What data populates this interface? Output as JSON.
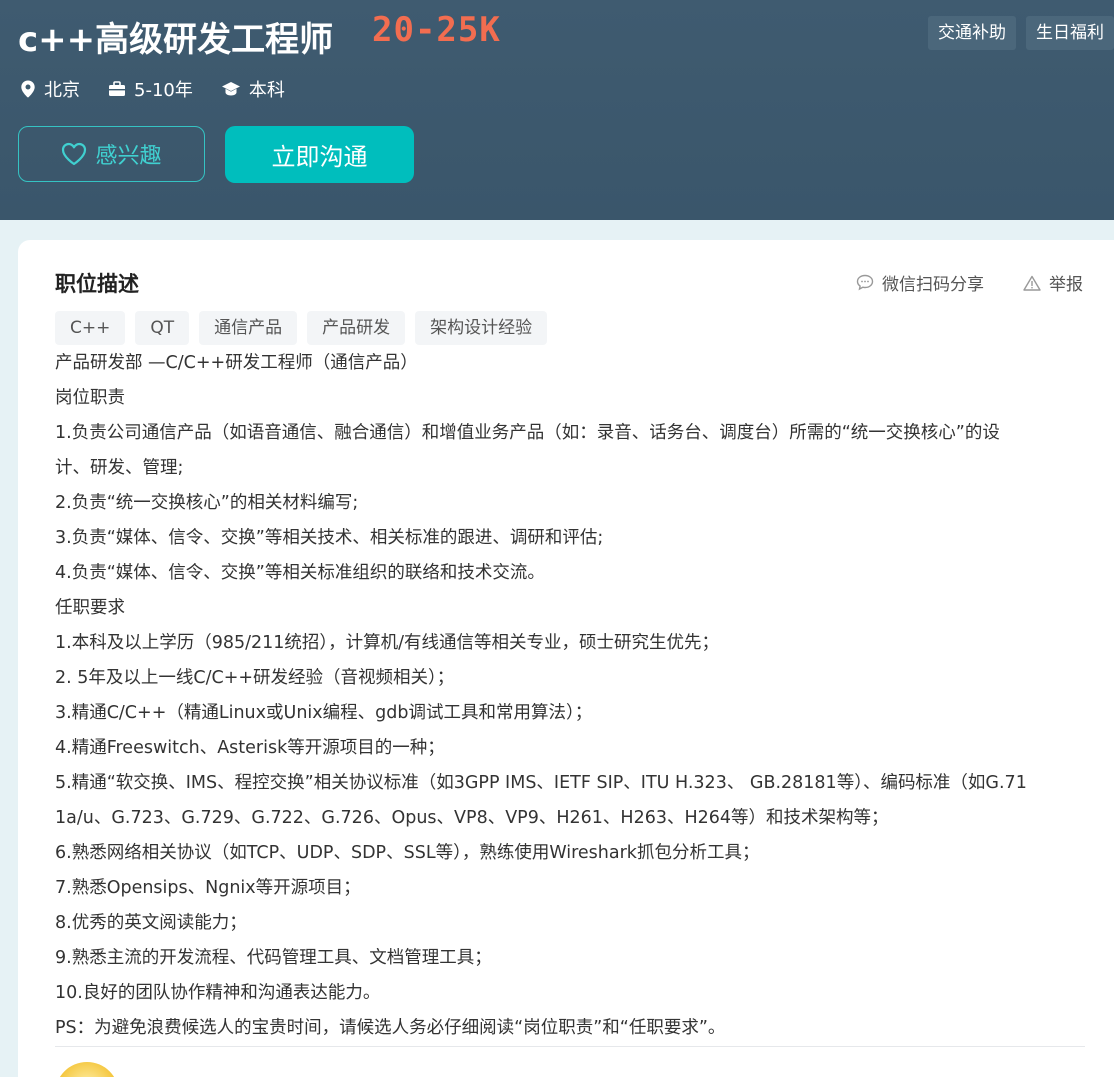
{
  "header": {
    "title": "c++高级研发工程师",
    "salary": "20-25K",
    "welfare": [
      "交通补助",
      "生日福利"
    ],
    "meta": {
      "city": "北京",
      "experience": "5-10年",
      "degree": "本科"
    },
    "buttons": {
      "interest": "感兴趣",
      "chat": "立即沟通"
    }
  },
  "card": {
    "section_title": "职位描述",
    "share": "微信扫码分享",
    "report": "举报",
    "skills": [
      "C++",
      "QT",
      "通信产品",
      "产品研发",
      "架构设计经验"
    ],
    "description_lines": [
      "产品研发部 —C/C++研发工程师（通信产品）",
      "岗位职责",
      "1.负责公司通信产品（如语音通信、融合通信）和增值业务产品（如：录音、话务台、调度台）所需的“统一交换核心”的设",
      "计、研发、管理;",
      "2.负责“统一交换核心”的相关材料编写;",
      "3.负责“媒体、信令、交换”等相关技术、相关标准的跟进、调研和评估;",
      "4.负责“媒体、信令、交换”等相关标准组织的联络和技术交流。",
      "任职要求",
      "1.本科及以上学历（985/211统招），计算机/有线通信等相关专业，硕士研究生优先；",
      "2. 5年及以上一线C/C++研发经验（音视频相关）；",
      "3.精通C/C++（精通Linux或Unix编程、gdb调试工具和常用算法）；",
      "4.精通Freeswitch、Asterisk等开源项目的一种；",
      "5.精通“软交换、IMS、程控交换”相关协议标准（如3GPP IMS、IETF SIP、ITU H.323、 GB.28181等）、编码标准（如G.71",
      "1a/u、G.723、G.729、G.722、G.726、Opus、VP8、VP9、H261、H263、H264等）和技术架构等；",
      "6.熟悉网络相关协议（如TCP、UDP、SDP、SSL等），熟练使用Wireshark抓包分析工具；",
      "7.熟悉Opensips、Ngnix等开源项目；",
      "8.优秀的英文阅读能力；",
      "9.熟悉主流的开发流程、代码管理工具、文档管理工具；",
      "10.良好的团队协作精神和沟通表达能力。",
      "PS：为避免浪费候选人的宝贵时间，请候选人务必仔细阅读“岗位职责”和“任职要求”。"
    ]
  },
  "colors": {
    "header_bg": "#3c5a6e",
    "salary": "#f26d50",
    "accent": "#00bebd"
  }
}
